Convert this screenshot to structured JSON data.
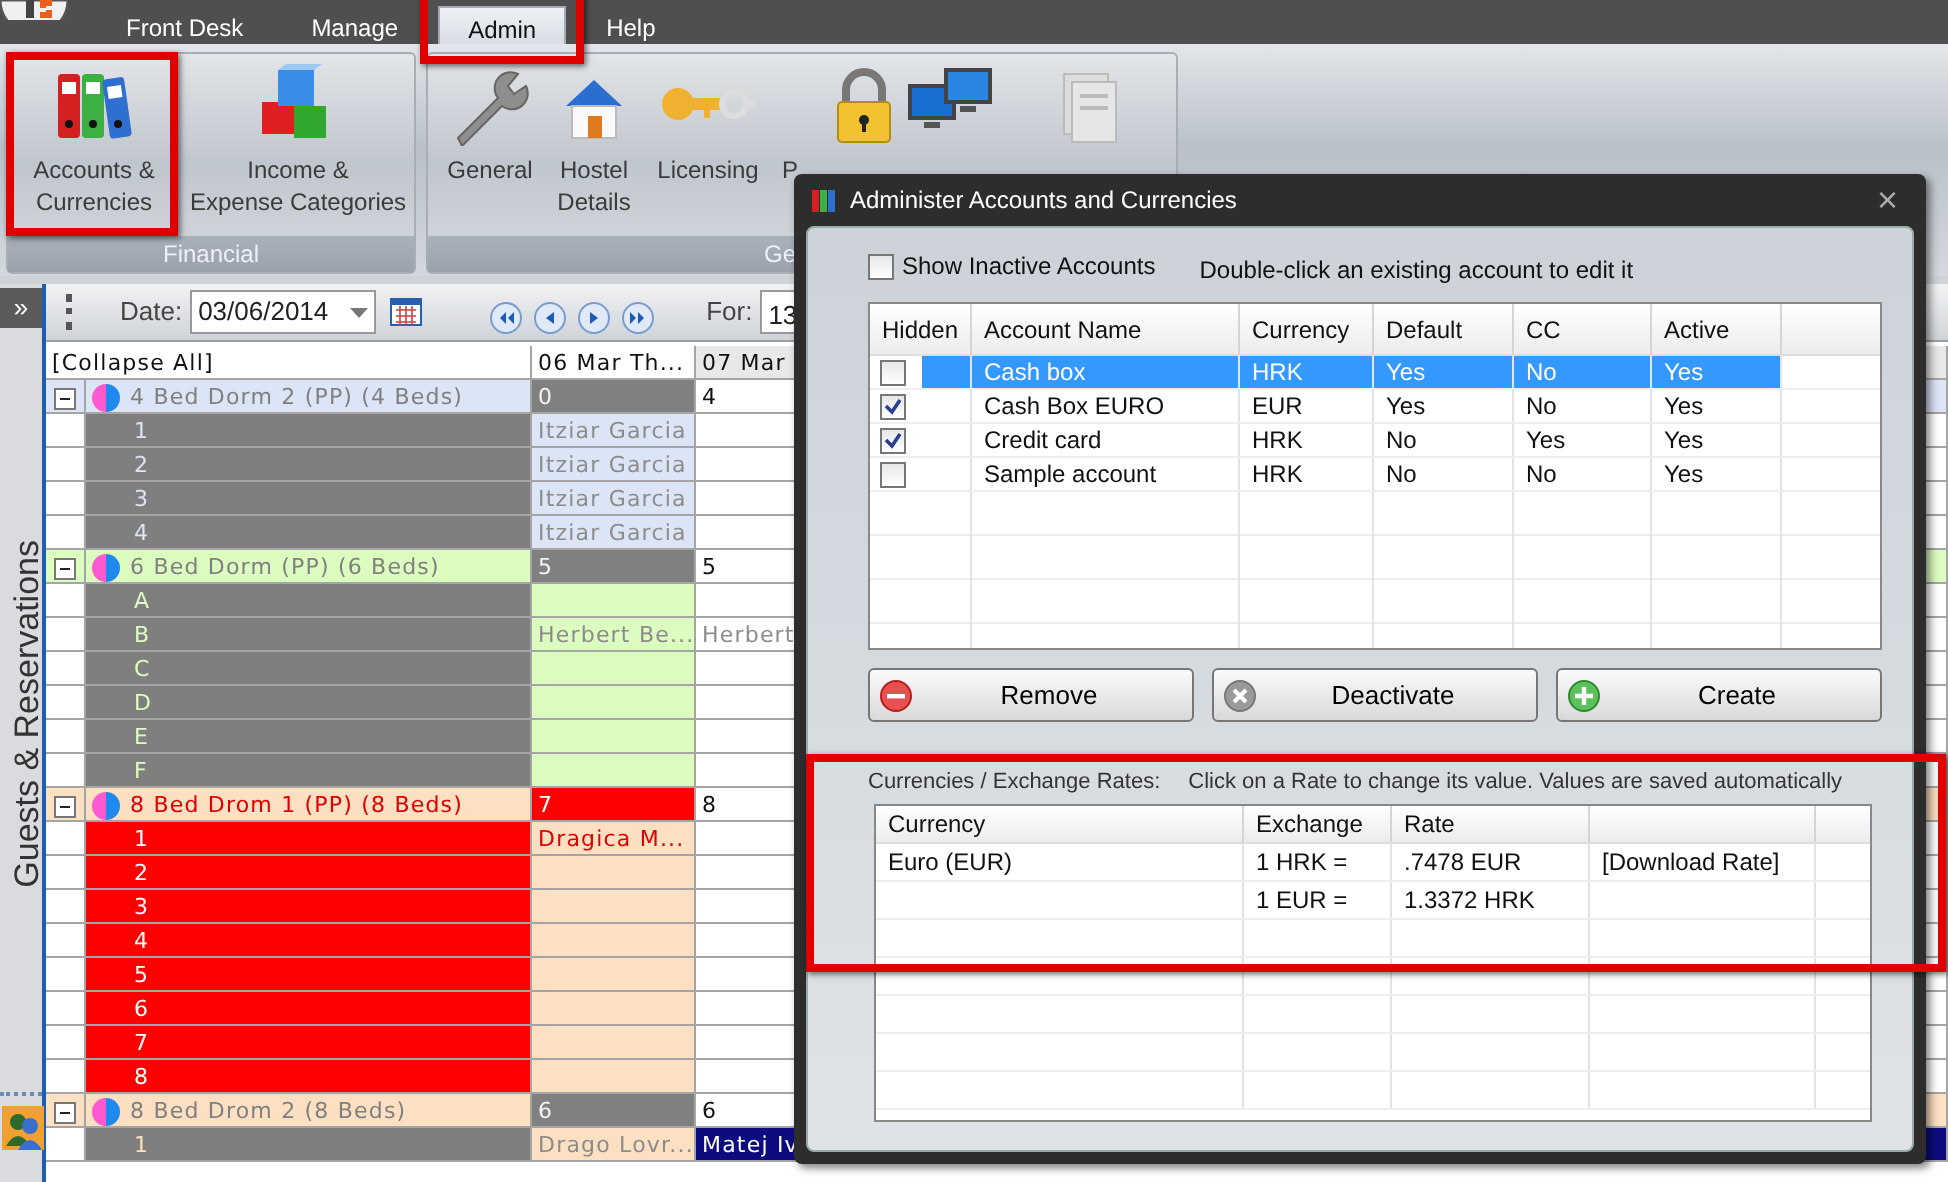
{
  "menu": [
    {
      "label": "Front Desk",
      "selected": false,
      "highlighted": false
    },
    {
      "label": "Manage",
      "selected": false,
      "highlighted": false
    },
    {
      "label": "Admin",
      "selected": true,
      "highlighted": true
    },
    {
      "label": "Help",
      "selected": false,
      "highlighted": false
    }
  ],
  "ribbon": {
    "groups": [
      {
        "label": "Financial",
        "items": [
          {
            "label": "Accounts &\nCurrencies",
            "highlighted": true
          },
          {
            "label": "Income &\nExpense Categories",
            "highlighted": false
          }
        ]
      },
      {
        "label": "Ge",
        "items": [
          {
            "label": "General",
            "highlighted": false
          },
          {
            "label": "Hostel\nDetails",
            "highlighted": false
          },
          {
            "label": "Licensing",
            "highlighted": false
          },
          {
            "label": "P",
            "highlighted": false
          },
          {
            "highlighted": false
          },
          {
            "highlighted": false
          }
        ]
      }
    ]
  },
  "side_panel": {
    "expand": "»",
    "title": "Guests & Reservations"
  },
  "schedule": {
    "toolbar": {
      "date_label": "Date:",
      "date": "03/06/2014",
      "for_label": "For:",
      "for_value": "13"
    },
    "header": {
      "collapse": "[Collapse All]",
      "day_1": "06 Mar Th...",
      "day_2": "07 Mar"
    },
    "groups": [
      {
        "name": "4 Bed Dorm 2 (PP) (4 Beds)",
        "kind": "normal",
        "color": "#dbe5f5",
        "count_1": "0",
        "count_2": "4",
        "beds": [
          {
            "label": "1",
            "guest_1": "Itziar Garcia",
            "selected": false
          },
          {
            "label": "2",
            "guest_1": "Itziar Garcia",
            "selected": false
          },
          {
            "label": "3",
            "guest_1": "Itziar Garcia",
            "selected": false
          },
          {
            "label": "4",
            "guest_1": "Itziar Garcia",
            "selected": false
          }
        ]
      },
      {
        "name": "6 Bed Dorm (PP) (6 Beds)",
        "kind": "normal",
        "color": "#ddfcc0",
        "count_1": "5",
        "count_2": "5",
        "beds": [
          {
            "label": "A",
            "selected": false
          },
          {
            "label": "B",
            "guest_1": "Herbert Be...",
            "guest_2": "Herbert",
            "selected": false
          },
          {
            "label": "C",
            "selected": false
          },
          {
            "label": "D",
            "selected": false
          },
          {
            "label": "E",
            "selected": false
          },
          {
            "label": "F",
            "selected": false
          }
        ]
      },
      {
        "name": "8 Bed Drom 1 (PP) (8 Beds)",
        "kind": "alert",
        "color": "#fddfc2",
        "count_1": "7",
        "count_2": "8",
        "beds": [
          {
            "label": "1",
            "guest_1": "Dragica  M...",
            "selected": false
          },
          {
            "label": "2",
            "selected": false
          },
          {
            "label": "3",
            "selected": false
          },
          {
            "label": "4",
            "selected": false
          },
          {
            "label": "5",
            "selected": false
          },
          {
            "label": "6",
            "selected": false
          },
          {
            "label": "7",
            "selected": false
          },
          {
            "label": "8",
            "selected": false
          }
        ]
      },
      {
        "name": "8 Bed Drom 2 (8 Beds)",
        "kind": "normal",
        "color": "#fddfc2",
        "count_1": "6",
        "count_2": "6",
        "beds": [
          {
            "label": "1",
            "guest_1": "Drago Lovr...",
            "guest_2": "Matej Iv",
            "selected": true
          }
        ]
      }
    ]
  },
  "dialog": {
    "title": "Administer Accounts and Currencies",
    "close": "×",
    "show_inactive": {
      "label": "Show Inactive Accounts",
      "checked": false
    },
    "hint": "Double-click an existing account to edit it",
    "accounts": {
      "hidden_column": "Hidden",
      "columns": [
        "Account Name",
        "Currency",
        "Default",
        "CC",
        "Active"
      ],
      "rows": [
        {
          "hidden": false,
          "selected": true,
          "cells": [
            "Cash box",
            "HRK",
            "Yes",
            "No",
            "Yes"
          ]
        },
        {
          "hidden": true,
          "selected": false,
          "cells": [
            "Cash Box EURO",
            "EUR",
            "Yes",
            "No",
            "Yes"
          ]
        },
        {
          "hidden": true,
          "selected": false,
          "cells": [
            "Credit card",
            "HRK",
            "No",
            "Yes",
            "Yes"
          ]
        },
        {
          "hidden": false,
          "selected": false,
          "cells": [
            "Sample account",
            "HRK",
            "No",
            "No",
            "Yes"
          ]
        }
      ]
    },
    "buttons": [
      {
        "label": "Remove",
        "kind": "remove"
      },
      {
        "label": "Deactivate",
        "kind": "deactivate"
      },
      {
        "label": "Create",
        "kind": "create"
      }
    ],
    "currencies": {
      "highlighted": true,
      "label": "Currencies / Exchange Rates:",
      "hint": "Click on a Rate to change its value.  Values are saved automatically",
      "columns": [
        "Currency",
        "Exchange",
        "Rate"
      ],
      "rows": [
        {
          "currency": "Euro (EUR)",
          "exchange": "1 HRK =",
          "rate": ".7478 EUR",
          "action": "[Download Rate]"
        },
        {
          "exchange": "1 EUR =",
          "rate": "1.3372 HRK"
        }
      ]
    }
  }
}
